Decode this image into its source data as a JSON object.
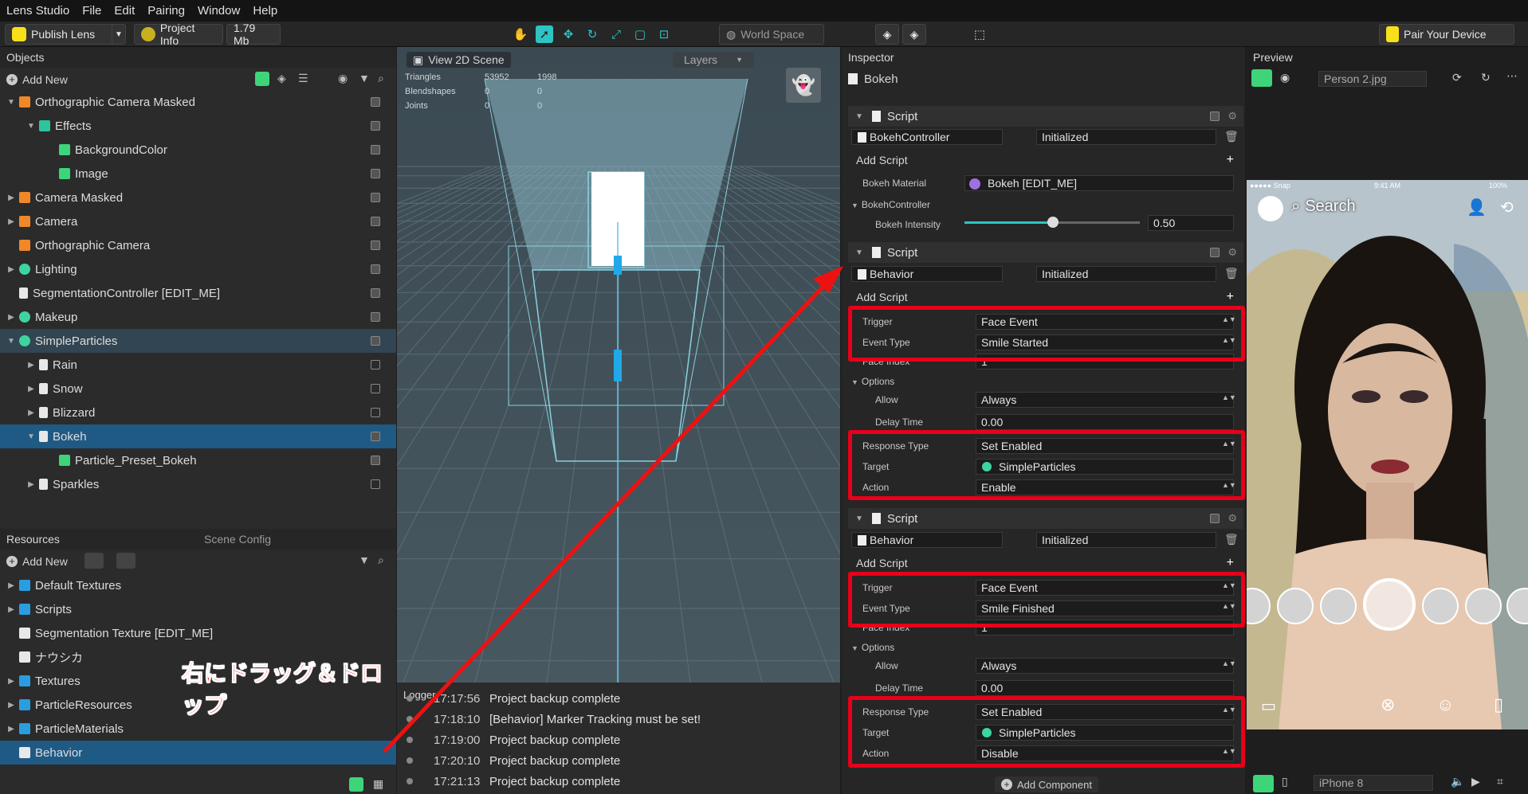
{
  "menu": [
    "Lens Studio",
    "File",
    "Edit",
    "Pairing",
    "Window",
    "Help"
  ],
  "toolbar": {
    "publish": "Publish Lens",
    "project_info": "Project Info",
    "size": "1.79 Mb",
    "space": "World Space",
    "pair": "Pair Your Device"
  },
  "objects": {
    "title": "Objects",
    "add_new": "Add New",
    "items": [
      {
        "label": "Orthographic Camera Masked",
        "depth": 0,
        "arrow": "▼",
        "icon": "camera",
        "color": "#f0882a"
      },
      {
        "label": "Effects",
        "depth": 1,
        "arrow": "▼",
        "icon": "effects",
        "color": "#2ec4a0"
      },
      {
        "label": "BackgroundColor",
        "depth": 2,
        "arrow": "",
        "icon": "mesh",
        "color": "#3ed47a"
      },
      {
        "label": "Image",
        "depth": 2,
        "arrow": "",
        "icon": "mesh",
        "color": "#3ed47a"
      },
      {
        "label": "Camera Masked",
        "depth": 0,
        "arrow": "▶",
        "icon": "camera",
        "color": "#f0882a"
      },
      {
        "label": "Camera",
        "depth": 0,
        "arrow": "▶",
        "icon": "camera",
        "color": "#f0882a"
      },
      {
        "label": "Orthographic Camera",
        "depth": 0,
        "arrow": "",
        "icon": "camera",
        "color": "#f0882a"
      },
      {
        "label": "Lighting",
        "depth": 0,
        "arrow": "▶",
        "icon": "light",
        "color": "#3ed4a0"
      },
      {
        "label": "SegmentationController [EDIT_ME]",
        "depth": 0,
        "arrow": "",
        "icon": "script",
        "color": "#e8e8e8"
      },
      {
        "label": "Makeup",
        "depth": 0,
        "arrow": "▶",
        "icon": "light",
        "color": "#3ed4a0"
      },
      {
        "label": "SimpleParticles",
        "depth": 0,
        "arrow": "▼",
        "icon": "light",
        "color": "#3ed4a0"
      },
      {
        "label": "Rain",
        "depth": 1,
        "arrow": "▶",
        "icon": "script",
        "color": "#e8e8e8"
      },
      {
        "label": "Snow",
        "depth": 1,
        "arrow": "▶",
        "icon": "script",
        "color": "#e8e8e8"
      },
      {
        "label": "Blizzard",
        "depth": 1,
        "arrow": "▶",
        "icon": "script",
        "color": "#e8e8e8"
      },
      {
        "label": "Bokeh",
        "depth": 1,
        "arrow": "▼",
        "icon": "script",
        "color": "#e8e8e8"
      },
      {
        "label": "Particle_Preset_Bokeh",
        "depth": 2,
        "arrow": "",
        "icon": "mesh",
        "color": "#3ed47a"
      },
      {
        "label": "Sparkles",
        "depth": 1,
        "arrow": "▶",
        "icon": "script",
        "color": "#e8e8e8"
      }
    ]
  },
  "resources": {
    "title": "Resources",
    "scene_config": "Scene Config",
    "add_new": "Add New",
    "items": [
      {
        "label": "Default Textures",
        "icon": "folder"
      },
      {
        "label": "Scripts",
        "icon": "folder"
      },
      {
        "label": "Segmentation Texture [EDIT_ME]",
        "icon": "texture"
      },
      {
        "label": "ナウシカ",
        "icon": "image"
      },
      {
        "label": "Textures",
        "icon": "folder"
      },
      {
        "label": "ParticleResources",
        "icon": "folder"
      },
      {
        "label": "ParticleMaterials",
        "icon": "folder"
      },
      {
        "label": "Behavior",
        "icon": "script"
      }
    ],
    "annotation": "右にドラッグ＆ドロップ"
  },
  "scene": {
    "view_2d": "View 2D Scene",
    "layers": "Layers",
    "stats": [
      {
        "k": "Triangles",
        "a": "53952",
        "b": "1998"
      },
      {
        "k": "Blendshapes",
        "a": "0",
        "b": "0"
      },
      {
        "k": "Joints",
        "a": "0",
        "b": "0"
      }
    ]
  },
  "logger": {
    "title": "Logger",
    "lines": [
      {
        "t": "17:17:56",
        "m": "Project backup complete"
      },
      {
        "t": "17:18:10",
        "m": "[Behavior] Marker Tracking must be set!"
      },
      {
        "t": "17:19:00",
        "m": "Project backup complete"
      },
      {
        "t": "17:20:10",
        "m": "Project backup complete"
      },
      {
        "t": "17:21:13",
        "m": "Project backup complete"
      }
    ]
  },
  "inspector": {
    "title": "Inspector",
    "object": "Bokeh",
    "script_label": "Script",
    "add_script": "Add Script",
    "initialized": "Initialized",
    "s1": {
      "name": "BokehController",
      "bokeh_material_label": "Bokeh Material",
      "bokeh_material": "Bokeh [EDIT_ME]",
      "group": "BokehController",
      "intensity_label": "Bokeh Intensity",
      "intensity": "0.50"
    },
    "s2": {
      "name": "Behavior",
      "trigger_label": "Trigger",
      "trigger": "Face Event",
      "event_label": "Event Type",
      "event": "Smile Started",
      "face_index_label": "Face Index",
      "face_index": "1",
      "options_label": "Options",
      "allow_label": "Allow",
      "allow": "Always",
      "delay_label": "Delay Time",
      "delay": "0.00",
      "response_label": "Response Type",
      "response": "Set Enabled",
      "target_label": "Target",
      "target": "SimpleParticles",
      "action_label": "Action",
      "action": "Enable"
    },
    "s3": {
      "name": "Behavior",
      "trigger": "Face Event",
      "event": "Smile Finished",
      "face_index": "1",
      "allow": "Always",
      "delay": "0.00",
      "response": "Set Enabled",
      "target": "SimpleParticles",
      "action": "Disable"
    },
    "add_component": "Add Component"
  },
  "preview": {
    "title": "Preview",
    "image": "Person 2.jpg",
    "search": "Search",
    "carrier": "●●●●● Snap",
    "time": "9:41 AM",
    "battery": "100%",
    "device": "iPhone 8"
  },
  "colors": {
    "accent": "#2ec4c4",
    "selection": "#1f5a85",
    "highlight": "#e8001a"
  }
}
